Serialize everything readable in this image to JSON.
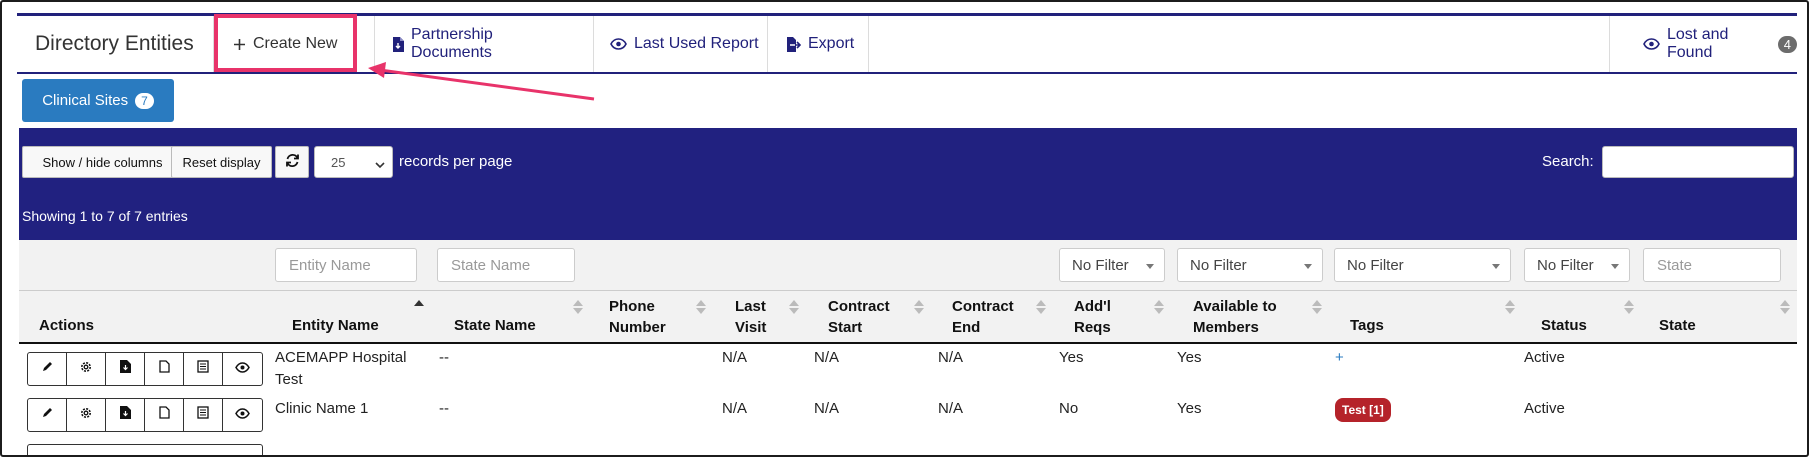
{
  "app": {
    "title": "Directory Entities"
  },
  "nav": {
    "create_new": "Create New",
    "partnership_documents": "Partnership Documents",
    "last_used_report": "Last Used Report",
    "export": "Export",
    "lost_and_found": "Lost and Found",
    "lost_and_found_count": "4"
  },
  "tab": {
    "label": "Clinical Sites",
    "count": "7"
  },
  "toolbar": {
    "show_hide_columns": "Show / hide columns",
    "reset_display": "Reset display",
    "records_per_page_value": "25",
    "records_per_page_label": "records per page",
    "search_label": "Search:",
    "search_value": ""
  },
  "summary": "Showing 1 to 7 of 7 entries",
  "filters": {
    "entity_name_placeholder": "Entity Name",
    "state_name_placeholder": "State Name",
    "addl_reqs": "No Filter",
    "available_to_members": "No Filter",
    "tags": "No Filter",
    "status": "No Filter",
    "state_placeholder": "State"
  },
  "columns": {
    "actions": "Actions",
    "entity_name": "Entity Name",
    "state_name": "State Name",
    "phone_1": "Phone",
    "phone_2": "Number",
    "last_visit_1": "Last",
    "last_visit_2": "Visit",
    "contract_start_1": "Contract",
    "contract_start_2": "Start",
    "contract_end_1": "Contract",
    "contract_end_2": "End",
    "addl_reqs_1": "Add'l",
    "addl_reqs_2": "Reqs",
    "available_1": "Available to",
    "available_2": "Members",
    "tags": "Tags",
    "status": "Status",
    "state": "State"
  },
  "rows": [
    {
      "entity_name_1": "ACEMAPP Hospital",
      "entity_name_2": "Test",
      "state_name": "--",
      "phone": "",
      "last_visit": "N/A",
      "contract_start": "N/A",
      "contract_end": "N/A",
      "addl_reqs": "Yes",
      "available": "Yes",
      "tags": "+",
      "status": "Active",
      "state": ""
    },
    {
      "entity_name_1": "Clinic Name 1",
      "state_name": "--",
      "phone": "",
      "last_visit": "N/A",
      "contract_start": "N/A",
      "contract_end": "N/A",
      "addl_reqs": "No",
      "available": "Yes",
      "tags": "Test [1]",
      "status": "Active",
      "state": ""
    }
  ],
  "colors": {
    "navy": "#21217b",
    "tab_blue": "#2a7bc0",
    "highlight": "#e8336a",
    "tag_red": "#b5232a"
  },
  "icons": [
    "plus-icon",
    "document-icon",
    "eye-icon",
    "export-icon",
    "refresh-icon",
    "pencil-icon",
    "gear-icon",
    "file-icon",
    "list-icon"
  ]
}
